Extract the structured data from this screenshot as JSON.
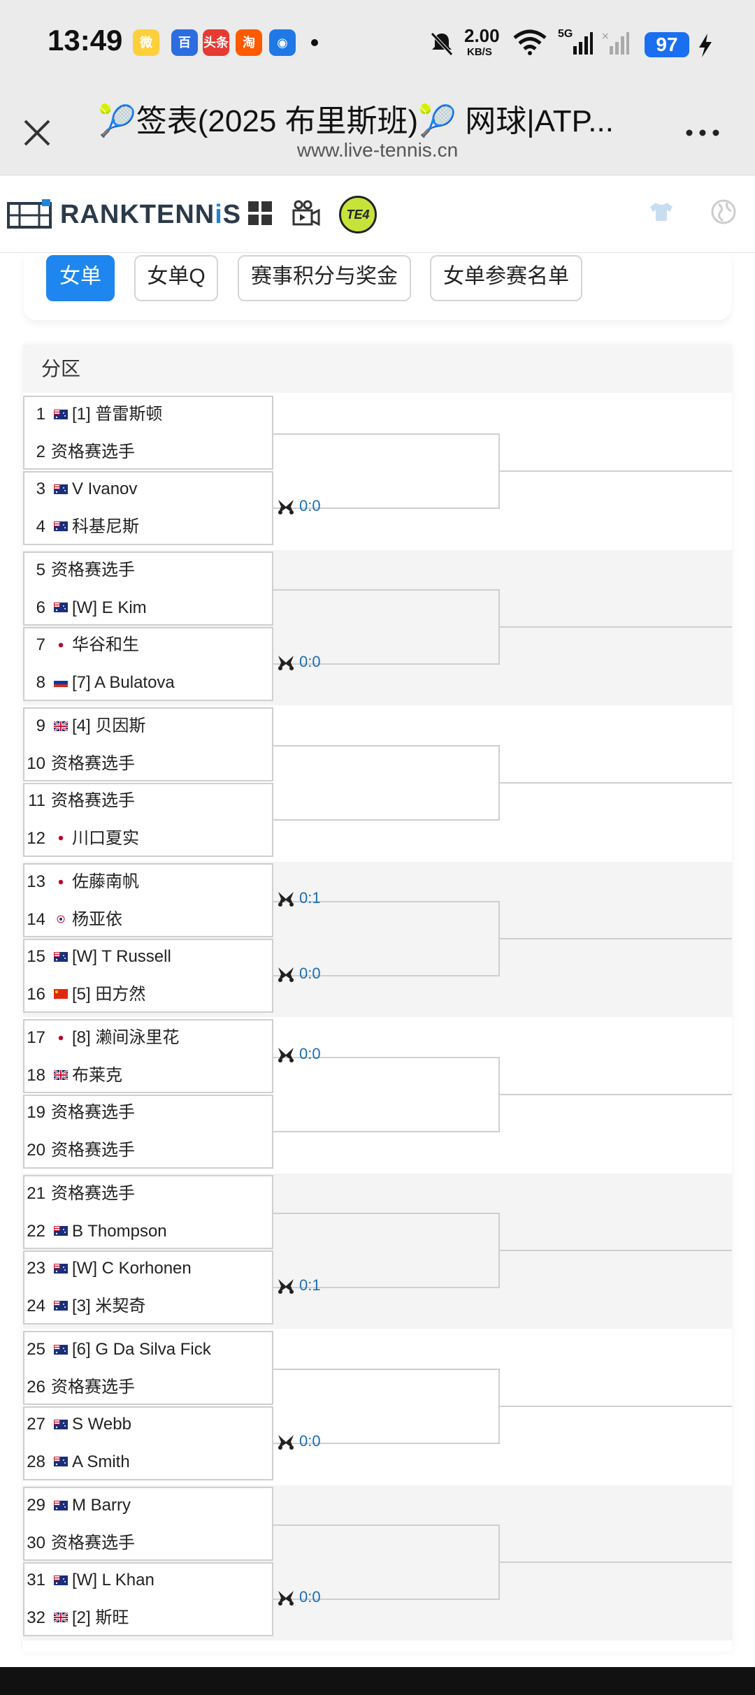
{
  "status_bar": {
    "time": "13:49",
    "net_speed": "2.00",
    "net_unit": "KB/S",
    "network": "5G",
    "battery": "97",
    "apps": [
      {
        "name": "weibo-icon",
        "color": "#ffcf3c",
        "glyph": "微"
      },
      {
        "name": "baidu-icon",
        "color": "#2c6de0",
        "glyph": "百"
      },
      {
        "name": "toutiao-icon",
        "color": "#e63a32",
        "glyph": "头条"
      },
      {
        "name": "taobao-icon",
        "color": "#ff5a00",
        "glyph": "淘"
      },
      {
        "name": "map-icon",
        "color": "#1f78e6",
        "glyph": "◉"
      }
    ]
  },
  "nav": {
    "title": "🎾签表(2025 布里斯班)🎾 网球|ATP...",
    "url": "www.live-tennis.cn"
  },
  "brand": {
    "name_a": "RANKTENN",
    "name_b": "i",
    "name_c": "S",
    "badge": "TE4"
  },
  "tabs": [
    {
      "label": "女单",
      "active": true
    },
    {
      "label": "女单Q",
      "active": false
    },
    {
      "label": "赛事积分与奖金",
      "active": false
    },
    {
      "label": "女单参赛名单",
      "active": false
    }
  ],
  "section_title": "分区",
  "players": [
    {
      "n": "1",
      "flag": "AU",
      "name": "[1] 普雷斯顿"
    },
    {
      "n": "2",
      "flag": "",
      "name": "资格赛选手"
    },
    {
      "n": "3",
      "flag": "AU",
      "name": "V Ivanov"
    },
    {
      "n": "4",
      "flag": "AU",
      "name": "科基尼斯"
    },
    {
      "n": "5",
      "flag": "",
      "name": "资格赛选手"
    },
    {
      "n": "6",
      "flag": "AU",
      "name": "[W] E Kim"
    },
    {
      "n": "7",
      "flag": "JP",
      "name": "华谷和生"
    },
    {
      "n": "8",
      "flag": "RU",
      "name": "[7] A Bulatova"
    },
    {
      "n": "9",
      "flag": "GB",
      "name": "[4] 贝因斯"
    },
    {
      "n": "10",
      "flag": "",
      "name": "资格赛选手"
    },
    {
      "n": "11",
      "flag": "",
      "name": "资格赛选手"
    },
    {
      "n": "12",
      "flag": "JP",
      "name": "川口夏实"
    },
    {
      "n": "13",
      "flag": "JP",
      "name": "佐藤南帆"
    },
    {
      "n": "14",
      "flag": "TW",
      "name": "杨亚依"
    },
    {
      "n": "15",
      "flag": "AU",
      "name": "[W] T Russell"
    },
    {
      "n": "16",
      "flag": "CN",
      "name": "[5] 田方然"
    },
    {
      "n": "17",
      "flag": "JP",
      "name": "[8] 濑间泳里花"
    },
    {
      "n": "18",
      "flag": "GB",
      "name": "布莱克"
    },
    {
      "n": "19",
      "flag": "",
      "name": "资格赛选手"
    },
    {
      "n": "20",
      "flag": "",
      "name": "资格赛选手"
    },
    {
      "n": "21",
      "flag": "",
      "name": "资格赛选手"
    },
    {
      "n": "22",
      "flag": "AU",
      "name": "B Thompson"
    },
    {
      "n": "23",
      "flag": "AU",
      "name": "[W] C Korhonen"
    },
    {
      "n": "24",
      "flag": "AU",
      "name": "[3] 米契奇"
    },
    {
      "n": "25",
      "flag": "AU",
      "name": "[6] G Da Silva Fick"
    },
    {
      "n": "26",
      "flag": "",
      "name": "资格赛选手"
    },
    {
      "n": "27",
      "flag": "AU",
      "name": "S Webb"
    },
    {
      "n": "28",
      "flag": "AU",
      "name": "A Smith"
    },
    {
      "n": "29",
      "flag": "AU",
      "name": "M Barry"
    },
    {
      "n": "30",
      "flag": "",
      "name": "资格赛选手"
    },
    {
      "n": "31",
      "flag": "AU",
      "name": "[W] L Khan"
    },
    {
      "n": "32",
      "flag": "GB",
      "name": "[2] 斯旺"
    }
  ],
  "scores": [
    "0:0",
    "0:0",
    "0:1",
    "0:0",
    "0:0",
    "0:1",
    "0:0",
    "0:0"
  ],
  "colors": {
    "accent": "#1e86ee",
    "score": "#1a6fb5",
    "band_alt": "#f4f4f4"
  }
}
